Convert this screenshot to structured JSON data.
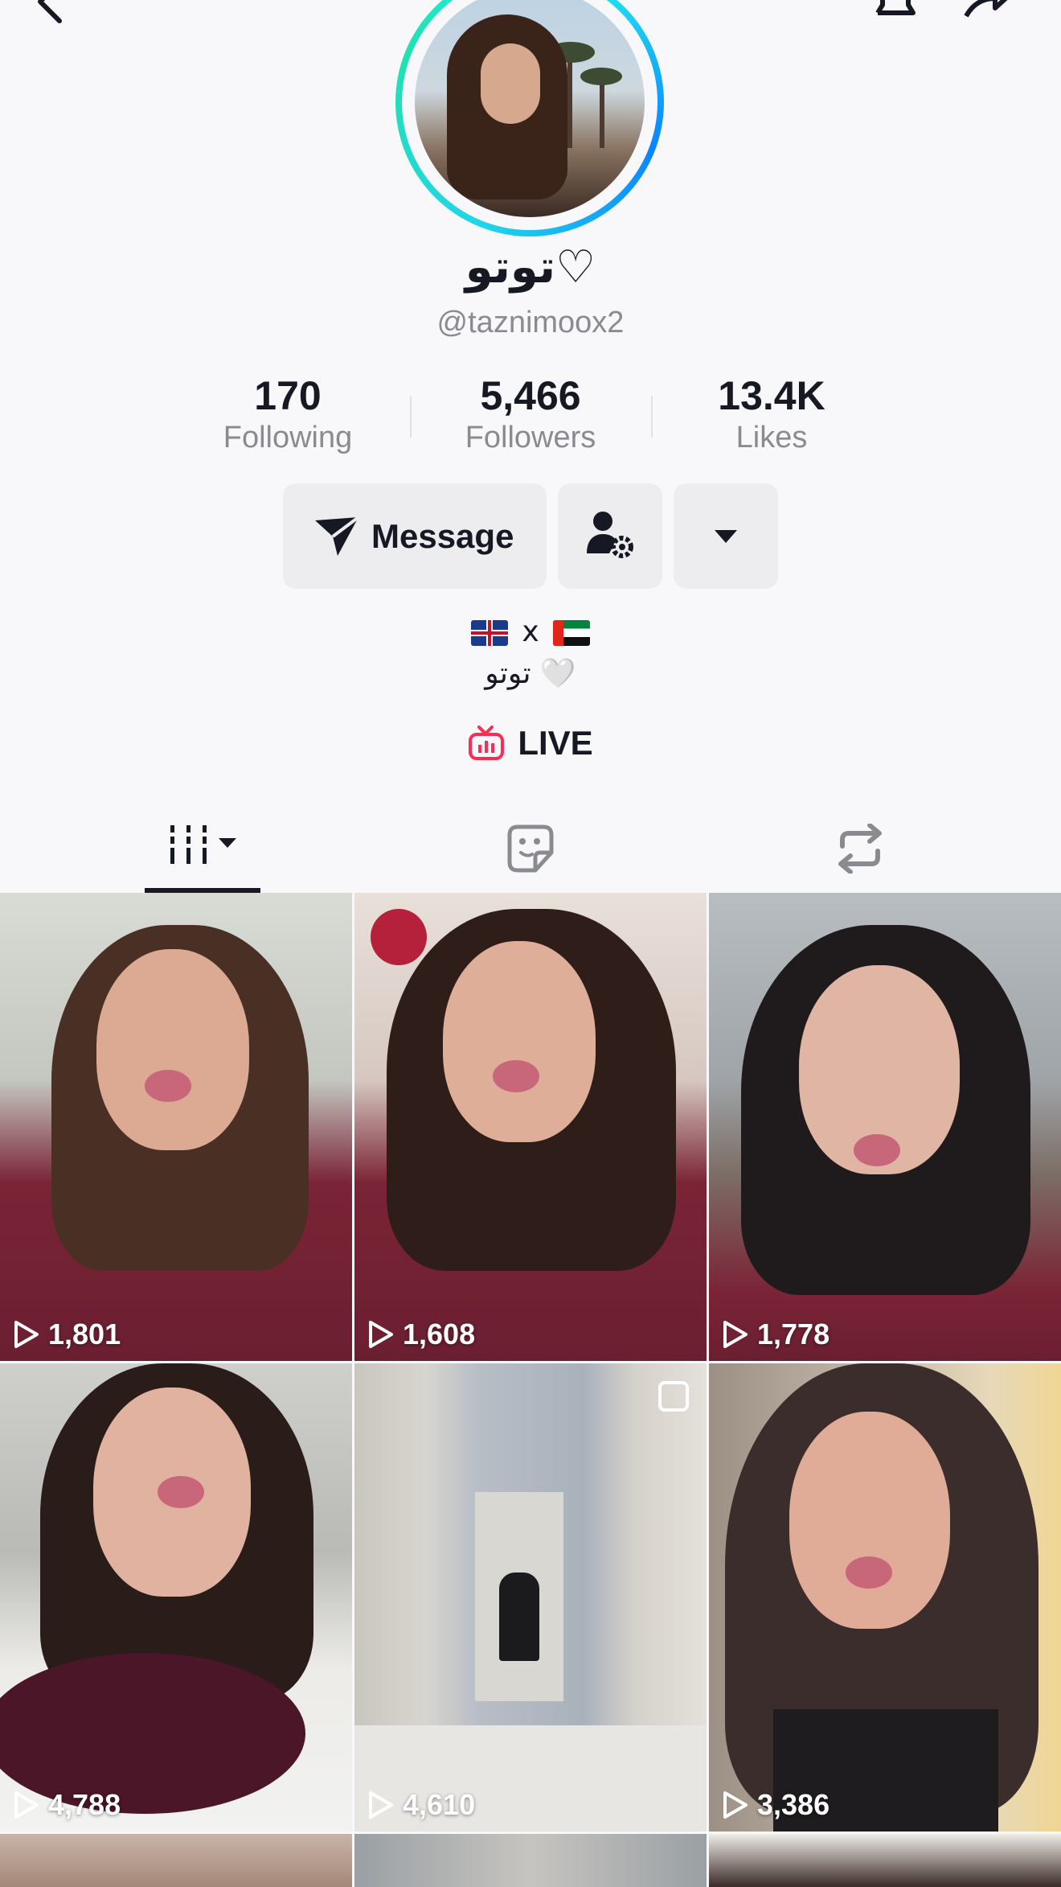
{
  "header": {
    "back_icon": "chevron-left-icon",
    "bell_icon": "bell-icon",
    "share_icon": "share-arrow-icon"
  },
  "profile": {
    "display_name": "توتو♡",
    "handle": "@taznimoox2"
  },
  "stats": [
    {
      "value": "170",
      "label": "Following"
    },
    {
      "value": "5,466",
      "label": "Followers"
    },
    {
      "value": "13.4K",
      "label": "Likes"
    }
  ],
  "actions": {
    "message_label": "Message",
    "message_icon": "send-icon",
    "friend_icon": "user-settings-icon",
    "more_icon": "caret-down-icon"
  },
  "bio": {
    "line1_separator": "x",
    "line2": "توتو 🤍"
  },
  "live": {
    "label": "LIVE",
    "icon": "tv-live-icon",
    "color": "#fe2c55"
  },
  "tabs": [
    {
      "name": "videos",
      "icon": "grid-bars-icon",
      "active": true
    },
    {
      "name": "stickers",
      "icon": "sticker-icon",
      "active": false
    },
    {
      "name": "reposts",
      "icon": "repost-icon",
      "active": false
    }
  ],
  "videos": [
    {
      "views": "1,801"
    },
    {
      "views": "1,608"
    },
    {
      "views": "1,778"
    },
    {
      "views": "4,788"
    },
    {
      "views": "4,610",
      "multi_image": true
    },
    {
      "views": "3,386"
    }
  ]
}
